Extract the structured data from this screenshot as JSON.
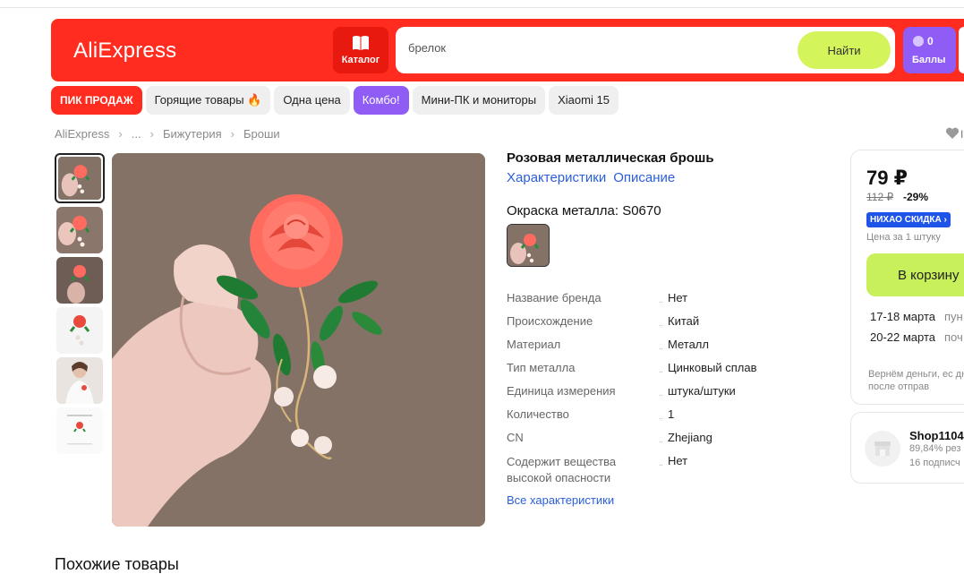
{
  "header": {
    "logo": "AliExpress",
    "catalog_label": "Каталог",
    "search_value": "брелок",
    "search_button": "Найти",
    "points_count": "0",
    "points_label": "Баллы",
    "brand_color": "#ff2c1f",
    "accent_color": "#d4f45b"
  },
  "chips": [
    {
      "label": "ПИК ПРОДАЖ"
    },
    {
      "label": "Горящие товары 🔥"
    },
    {
      "label": "Одна цена"
    },
    {
      "label": "Комбо!"
    },
    {
      "label": "Мини-ПК и мониторы"
    },
    {
      "label": "Xiaomi 15"
    }
  ],
  "breadcrumb": [
    "AliExpress",
    "...",
    "Бижутерия",
    "Броши"
  ],
  "product": {
    "title": "Розовая металлическая брошь",
    "link_specs": "Характеристики",
    "link_desc": "Описание",
    "color_label": "Окраска металла: S0670",
    "specs": [
      {
        "k": "Название бренда",
        "v": "Нет"
      },
      {
        "k": "Происхождение",
        "v": "Китай"
      },
      {
        "k": "Материал",
        "v": "Металл"
      },
      {
        "k": "Тип металла",
        "v": "Цинковый сплав"
      },
      {
        "k": "Единица измерения",
        "v": "штука/штуки"
      },
      {
        "k": "Количество",
        "v": "1"
      },
      {
        "k": "CN",
        "v": "Zhejiang"
      },
      {
        "k": "Содержит вещества высокой опасности",
        "v": "Нет"
      }
    ],
    "more_specs": "Все характеристики"
  },
  "buy": {
    "price": "79 ₽",
    "old_price": "112 ₽",
    "discount": "-29%",
    "badge": "НИХАО СКИДКА ›",
    "per_unit": "Цена за 1 штуку",
    "cart_button": "В корзину",
    "delivery1_date": "17-18 марта",
    "delivery1_sub": "пун",
    "delivery2_date": "20-22 марта",
    "delivery2_sub": "поч",
    "refund_text": "Вернём деньги, ес дней после отправ"
  },
  "shop": {
    "name": "Shop1104",
    "rating": "89,84% рез",
    "subscribers": "16 подписч"
  },
  "similar_title": "Похожие товары"
}
